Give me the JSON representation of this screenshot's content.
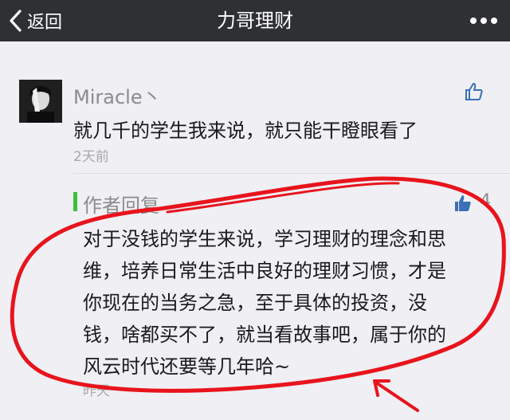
{
  "nav": {
    "back_label": "返回",
    "title": "力哥理财"
  },
  "comment": {
    "username": "Miracle丶",
    "text": "就几千的学生我来说，就只能干瞪眼看了",
    "time": "2天前"
  },
  "reply": {
    "header": "作者回复",
    "like_count": "4",
    "lines": [
      "对于没钱的学生来说，学习理财的理念和思",
      "维，培养日常生活中良好的理财习惯，才是",
      "你现在的当务之急，至于具体的投资，没",
      "钱，啥都买不了，就当看故事吧，属于你的",
      "风云时代还要等几年哈~"
    ],
    "time": "昨天"
  },
  "colors": {
    "navbar": "#2e3033",
    "background": "#efeff4",
    "like_icon": "#3b6fb6",
    "reply_bar": "#3fbf3f",
    "annotation": "#e8141c"
  }
}
